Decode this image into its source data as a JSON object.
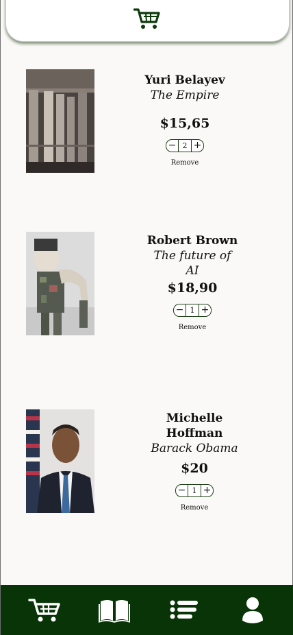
{
  "header": {
    "icon": "cart-icon"
  },
  "cart": {
    "items": [
      {
        "author": "Yuri Belayev",
        "title": "The Empire",
        "price": "$15,65",
        "quantity": "2",
        "remove_label": "Remove",
        "decrement": "−",
        "increment": "+"
      },
      {
        "author": "Robert Brown",
        "title_line1": "The future of",
        "title_line2": "AI",
        "price": "$18,90",
        "quantity": "1",
        "remove_label": "Remove",
        "decrement": "−",
        "increment": "+"
      },
      {
        "author_line1": "Michelle",
        "author_line2": "Hoffman",
        "title": "Barack Obama",
        "price": "$20",
        "quantity": "1",
        "remove_label": "Remove",
        "decrement": "−",
        "increment": "+"
      }
    ]
  },
  "nav": {
    "icons": [
      "cart-icon",
      "book-icon",
      "list-icon",
      "user-icon"
    ]
  },
  "colors": {
    "accent": "#083407",
    "background": "#faf9f7"
  }
}
